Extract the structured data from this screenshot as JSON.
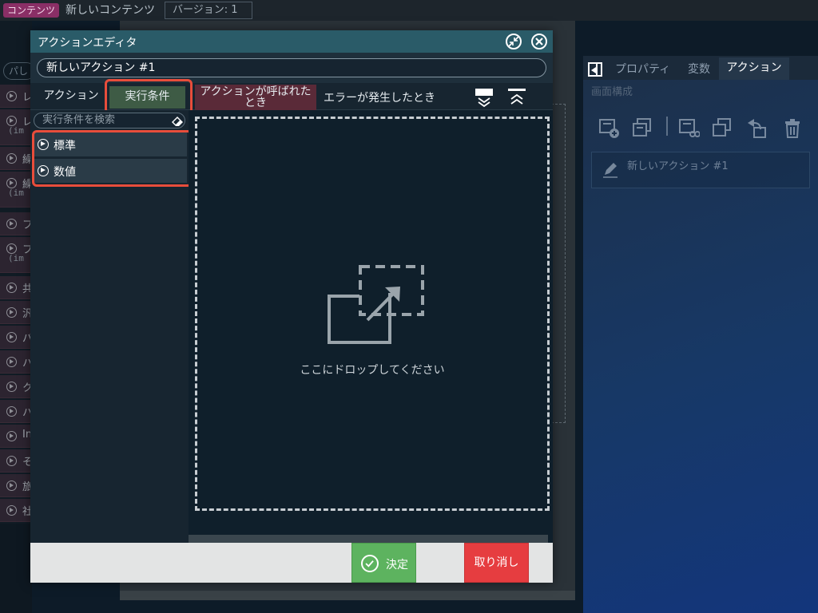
{
  "topbar": {
    "badge": "コンテンツ",
    "title": "新しいコンテンツ",
    "version": "バージョン: 1"
  },
  "background_left": {
    "search_placeholder": "パし",
    "rows": [
      {
        "label": "レ",
        "sub": ""
      },
      {
        "label": "レ",
        "sub": "(im"
      },
      {
        "label": "繰",
        "sub": ""
      },
      {
        "label": "繰",
        "sub": "(im"
      },
      {
        "label": "フ",
        "sub": ""
      },
      {
        "label": "フ",
        "sub": "(im"
      },
      {
        "label": "共",
        "sub": ""
      },
      {
        "label": "汎",
        "sub": ""
      },
      {
        "label": "パ",
        "sub": ""
      },
      {
        "label": "ハ",
        "sub": ""
      },
      {
        "label": "ク",
        "sub": ""
      },
      {
        "label": "ハ",
        "sub": ""
      },
      {
        "label": "In",
        "sub": ""
      },
      {
        "label": "そ",
        "sub": ""
      },
      {
        "label": "旅",
        "sub": ""
      },
      {
        "label": "社",
        "sub": ""
      }
    ]
  },
  "right_panel": {
    "tabs": [
      "プロパティ",
      "変数",
      "アクション"
    ],
    "active_tab": "アクション",
    "section_label": "画面構成",
    "toolbar_icons": [
      "add-action-icon",
      "copy-action-icon",
      "cut-action-icon",
      "paste-action-icon",
      "undo-action-icon",
      "trash-icon"
    ],
    "item_label": "新しいアクション #1",
    "item_icon": "pencil-icon"
  },
  "modal": {
    "title": "アクションエディタ",
    "action_name": "新しいアクション #1",
    "tabs": {
      "action": "アクション",
      "condition": "実行条件",
      "called": "アクションが呼ばれたとき",
      "error": "エラーが発生したとき"
    },
    "search_placeholder": "実行条件を検索",
    "categories": [
      "標準",
      "数値"
    ],
    "drop_text": "ここにドロップしてください",
    "ok_label": "決定",
    "cancel_label": "取り消し",
    "colors": {
      "title_bar": "#2a5b68",
      "active_tab": "#3e5b45",
      "called_tab": "#5a2a38",
      "highlight": "#e84d3b",
      "ok": "#5db35f",
      "cancel": "#e63d40"
    }
  }
}
